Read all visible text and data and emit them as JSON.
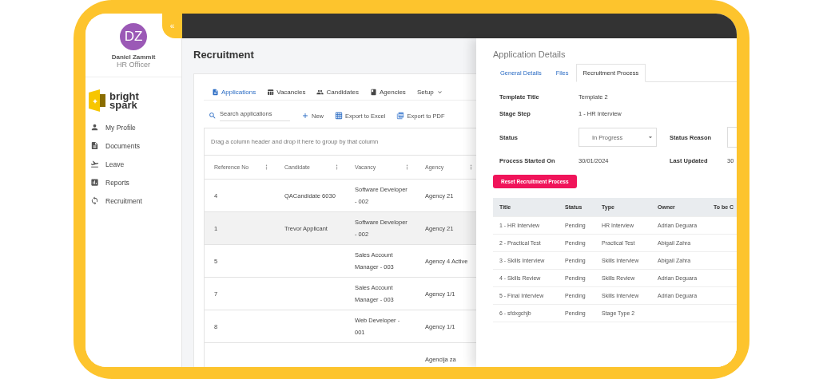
{
  "user": {
    "initials": "DZ",
    "name": "Daniel Zammit",
    "role": "HR Officer"
  },
  "logo": {
    "line_1": "bright",
    "line_2": "spark"
  },
  "sidebar": {
    "items": [
      {
        "label": "My Profile",
        "kind": "profile"
      },
      {
        "label": "Documents",
        "kind": "documents"
      },
      {
        "label": "Leave",
        "kind": "leave"
      },
      {
        "label": "Reports",
        "kind": "reports"
      },
      {
        "label": "Recruitment",
        "kind": "recruitment"
      }
    ]
  },
  "collapse_button": {
    "label": "«"
  },
  "page": {
    "title": "Recruitment"
  },
  "tabs": [
    {
      "label": "Applications",
      "kind": "applications",
      "selected": true
    },
    {
      "label": "Vacancies",
      "kind": "vacancies",
      "selected": false
    },
    {
      "label": "Candidates",
      "kind": "candidates",
      "selected": false
    },
    {
      "label": "Agencies",
      "kind": "agencies",
      "selected": false
    },
    {
      "label": "Setup",
      "kind": "menu",
      "selected": false
    }
  ],
  "toolbar": {
    "search": {
      "placeholder": "Search applications"
    },
    "actions": [
      {
        "label": "New",
        "kind": "new"
      },
      {
        "label": "Export to Excel",
        "kind": "excel"
      },
      {
        "label": "Export to PDF",
        "kind": "pdf"
      }
    ]
  },
  "grid": {
    "group_hint": "Drag a column header and drop it here to group by that column",
    "columns": [
      "Reference No",
      "Candidate",
      "Vacancy",
      "Agency"
    ],
    "rows": [
      {
        "cells": [
          "4",
          "QACandidate 6030",
          "Software Developer - 002",
          "Agency 21"
        ],
        "selected": false
      },
      {
        "cells": [
          "1",
          "Trevor Applicant",
          "Software Developer - 002",
          "Agency 21"
        ],
        "selected": true
      },
      {
        "cells": [
          "5",
          "",
          "Sales Account Manager - 003",
          "Agency 4 Active"
        ],
        "selected": false
      },
      {
        "cells": [
          "7",
          "",
          "Sales Account Manager - 003",
          "Agency 1/1"
        ],
        "selected": false
      },
      {
        "cells": [
          "8",
          "",
          "Web Developer - 001",
          "Agency 1/1"
        ],
        "selected": false
      },
      {
        "cells": [
          "",
          "",
          "",
          "Agencija za"
        ],
        "selected": false
      }
    ]
  },
  "drawer": {
    "title": "Application Details",
    "tabs": [
      {
        "label": "General Details",
        "selected": false
      },
      {
        "label": "Files",
        "selected": false
      },
      {
        "label": "Recruitment Process",
        "selected": true
      }
    ],
    "template_title": {
      "label": "Template Title",
      "value": "Template 2"
    },
    "stage_step": {
      "label": "Stage Step",
      "value": "1 - HR Interview"
    },
    "status": {
      "label": "Status",
      "value": "In Progress"
    },
    "status_reason": {
      "label": "Status Reason"
    },
    "process_started": {
      "label": "Process Started On",
      "value": "30/01/2024"
    },
    "last_updated": {
      "label": "Last Updated",
      "value": "30"
    },
    "reset_button": "Reset Recruitment Process",
    "stages": {
      "columns": [
        "Title",
        "Status",
        "Type",
        "Owner",
        "To be C"
      ],
      "rows": [
        [
          "1 - HR Interview",
          "Pending",
          "HR Interview",
          "Adrian Deguara"
        ],
        [
          "2 - Practical Test",
          "Pending",
          "Practical Test",
          "Abigail Zahra"
        ],
        [
          "3 - Skills Interview",
          "Pending",
          "Skills Interview",
          "Abigail Zahra"
        ],
        [
          "4 - Skills Review",
          "Pending",
          "Skills Review",
          "Adrian Deguara"
        ],
        [
          "5 - Final Interview",
          "Pending",
          "Skills Interview",
          "Adrian Deguara"
        ],
        [
          "6 - sfdxgchjb",
          "Pending",
          "Stage Type 2",
          ""
        ]
      ]
    }
  }
}
